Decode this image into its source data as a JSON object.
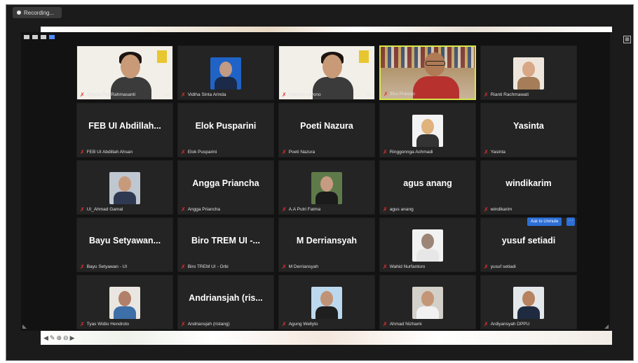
{
  "recording": {
    "label": "Recording..."
  },
  "controls": {
    "more_label": "···"
  },
  "ask_button": {
    "label": "Ask to Unmute",
    "more": "···"
  },
  "participants": [
    {
      "label": "Angela Puji Rahmasanti",
      "type": "video-slide",
      "active": false
    },
    {
      "label": "Vidiha Sinta Arinda",
      "type": "photo",
      "photo_bg": "#1f63c7",
      "skin": "#c39a84",
      "clothes": "#1a2a48"
    },
    {
      "label": "Fatimah Liwono",
      "type": "video-slide",
      "active": false
    },
    {
      "label": "Eko Prasojo",
      "type": "video-shelf",
      "active": true
    },
    {
      "label": "Rianti Rachmawati",
      "type": "photo",
      "photo_bg": "#eee6dc",
      "skin": "#d8a785",
      "clothes": "#a57d58"
    },
    {
      "label": "FEB UI Abdillah Ahsan",
      "big": "FEB UI Abdillah...",
      "type": "name"
    },
    {
      "label": "Elok Pusparini",
      "big": "Elok Pusparini",
      "type": "name"
    },
    {
      "label": "Poeti Nazura",
      "big": "Poeti Nazura",
      "type": "name"
    },
    {
      "label": "Ringgonnga Achmadi",
      "type": "photo",
      "photo_bg": "#f3f3f3",
      "skin": "#e0b27c",
      "clothes": "#333333"
    },
    {
      "label": "Yasinta",
      "big": "Yasinta",
      "type": "name"
    },
    {
      "label": "UI_Ahmad Gamal",
      "type": "photo",
      "photo_bg": "#bfc7d0",
      "skin": "#c89a7c",
      "clothes": "#2f3a52"
    },
    {
      "label": "Angga Priancha",
      "big": "Angga Priancha",
      "type": "name"
    },
    {
      "label": "A.A Putri Fatma",
      "type": "photo",
      "photo_bg": "#5f7a4a",
      "skin": "#c79b82",
      "clothes": "#1b1b1b"
    },
    {
      "label": "agus anang",
      "big": "agus anang",
      "type": "name"
    },
    {
      "label": "windikarim",
      "big": "windikarim",
      "type": "name"
    },
    {
      "label": "Bayu Setyawan - UI",
      "big": "Bayu  Setyawan...",
      "type": "name"
    },
    {
      "label": "Biro TREM UI - Orbi",
      "big": "Biro TREM UI -...",
      "type": "name"
    },
    {
      "label": "M Derriansyah",
      "big": "M Derriansyah",
      "type": "name"
    },
    {
      "label": "Wahid Nurfantoro",
      "type": "photo",
      "photo_bg": "#f2f2f2",
      "skin": "#9c8577",
      "clothes": "#e7e7e7"
    },
    {
      "label": "yusuf setiadi",
      "big": "yusuf setiadi",
      "type": "name"
    },
    {
      "label": "Tyas Widio Hendroto",
      "type": "photo",
      "photo_bg": "#e9e6e1",
      "skin": "#b1806a",
      "clothes": "#3d6fa8"
    },
    {
      "label": "Andriansjah (ristang)",
      "big": "Andriansjah  (ris...",
      "type": "name"
    },
    {
      "label": "Agung Wellyto",
      "type": "photo",
      "photo_bg": "#bcd8ee",
      "skin": "#c19376",
      "clothes": "#1f1f1f"
    },
    {
      "label": "Ahmad Nizhami",
      "type": "photo",
      "photo_bg": "#d2d0c9",
      "skin": "#c49576",
      "clothes": "#f1f1f1"
    },
    {
      "label": "Ardiyansyah DPPU",
      "type": "photo",
      "photo_bg": "#e4e7ea",
      "skin": "#b6825f",
      "clothes": "#1d2a40"
    }
  ]
}
